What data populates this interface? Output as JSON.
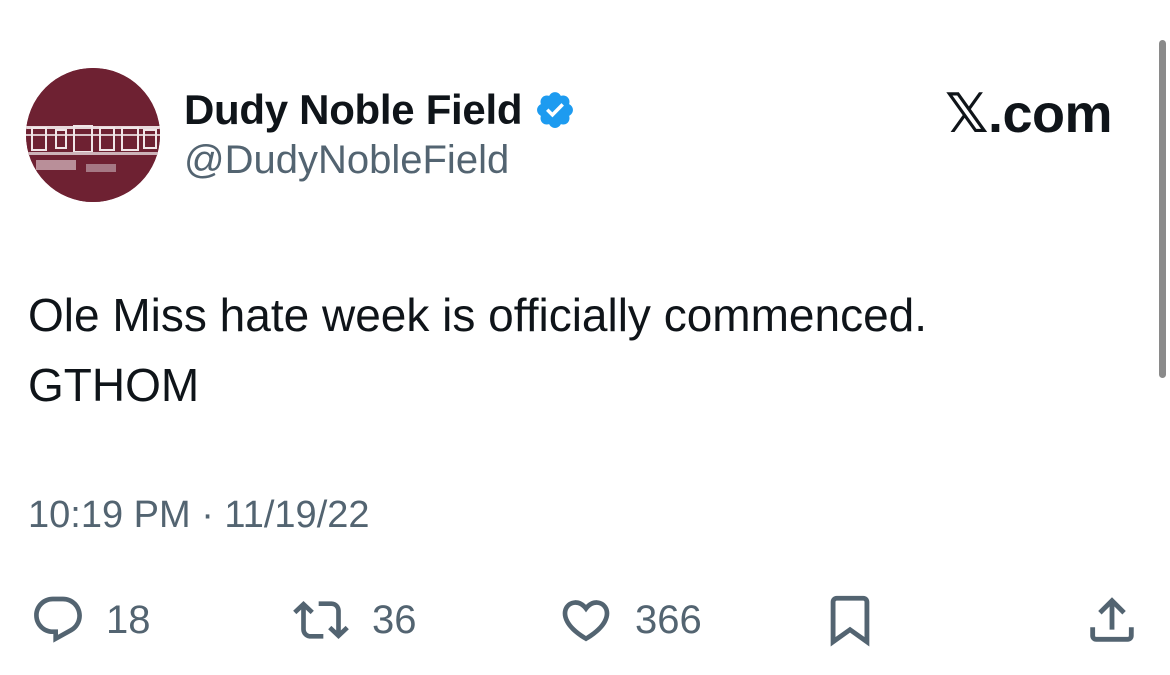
{
  "tweet": {
    "display_name": "Dudy Noble Field",
    "handle": "@DudyNobleField",
    "text": "Ole Miss hate week is officially commenced.\nGTHOM",
    "timestamp": "10:19 PM · 11/19/22"
  },
  "brand": {
    "label": "𝕏.com"
  },
  "actions": {
    "replies": {
      "icon": "reply-icon",
      "count": "18"
    },
    "retweets": {
      "icon": "retweet-icon",
      "count": "36"
    },
    "likes": {
      "icon": "heart-icon",
      "count": "366"
    },
    "bookmark": {
      "icon": "bookmark-icon"
    },
    "share": {
      "icon": "share-icon"
    }
  },
  "colors": {
    "avatar_bg": "#6e2132",
    "verified": "#1d9bf0",
    "text_primary": "#0f1419",
    "text_secondary": "#536471"
  }
}
